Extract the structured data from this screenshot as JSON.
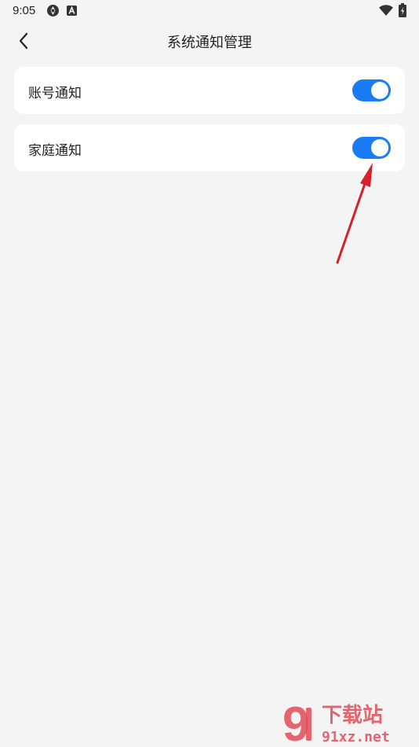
{
  "status_bar": {
    "time": "9:05",
    "icons": [
      "sync-icon",
      "a-badge-icon",
      "wifi-icon",
      "battery-icon"
    ]
  },
  "header": {
    "title": "系统通知管理",
    "back_icon": "chevron-left-icon"
  },
  "settings": [
    {
      "label": "账号通知",
      "enabled": true
    },
    {
      "label": "家庭通知",
      "enabled": true
    }
  ],
  "colors": {
    "accent": "#1a7cf5",
    "background": "#f4f4f4",
    "card": "#ffffff",
    "annotation": "#d8202a"
  },
  "watermark": {
    "mark": "9",
    "brand": "下载站",
    "domain": "91xz.net"
  }
}
